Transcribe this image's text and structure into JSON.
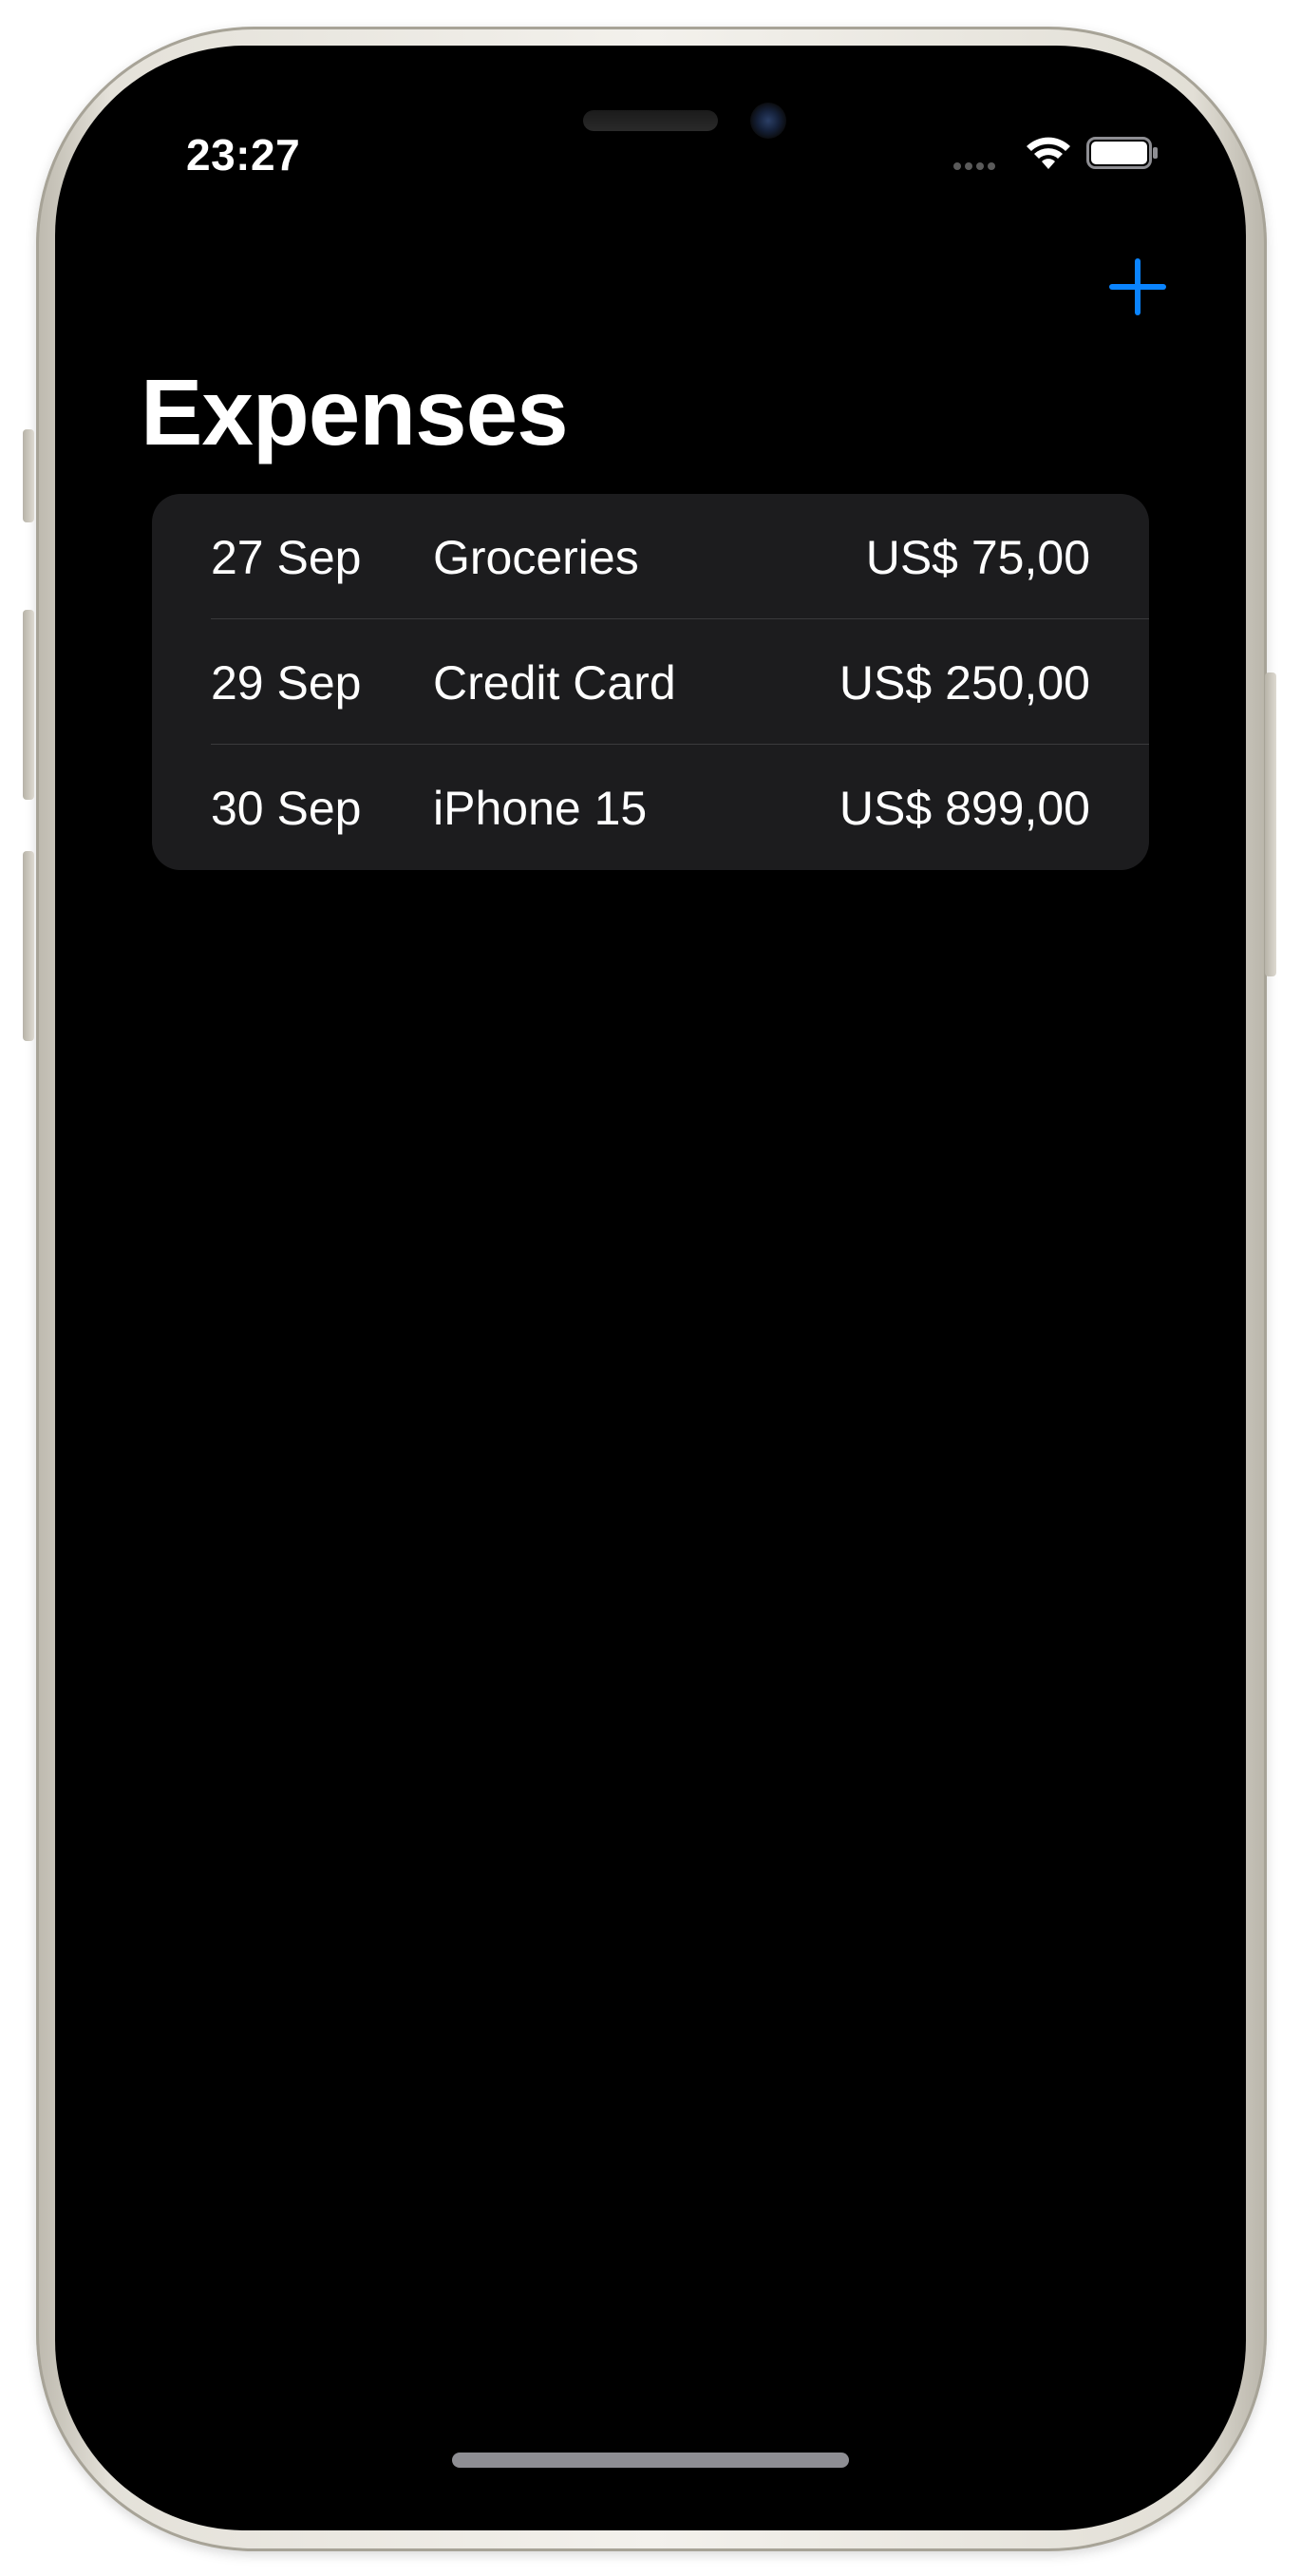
{
  "status_bar": {
    "time": "23:27"
  },
  "nav": {
    "title": "Expenses",
    "add_icon": "plus-icon",
    "accent_color": "#0a84ff"
  },
  "expenses": [
    {
      "date": "27 Sep",
      "description": "Groceries",
      "amount": "US$ 75,00"
    },
    {
      "date": "29 Sep",
      "description": "Credit Card",
      "amount": "US$ 250,00"
    },
    {
      "date": "30 Sep",
      "description": "iPhone 15",
      "amount": "US$ 899,00"
    }
  ]
}
